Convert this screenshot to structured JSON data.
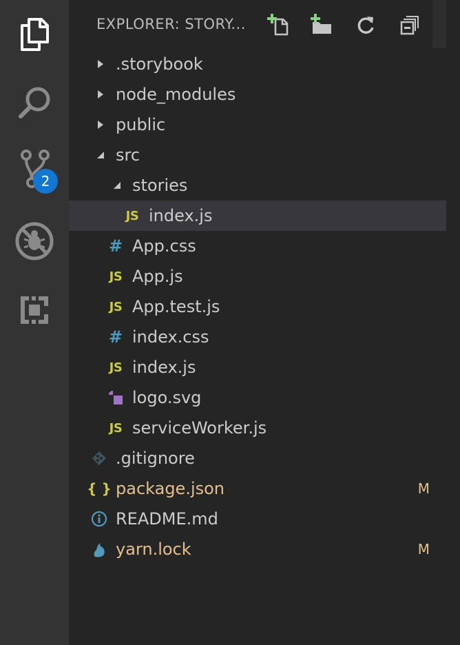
{
  "activity_bar": {
    "items": [
      {
        "name": "explorer",
        "icon": "files-icon"
      },
      {
        "name": "search",
        "icon": "search-icon"
      },
      {
        "name": "source-control",
        "icon": "source-control-icon",
        "badge": "2"
      },
      {
        "name": "debug",
        "icon": "debug-disabled-icon"
      },
      {
        "name": "extensions",
        "icon": "extensions-icon"
      }
    ],
    "badge_color": "#1177d1"
  },
  "explorer": {
    "title": "EXPLORER: STORY...",
    "actions": [
      {
        "name": "new-file",
        "icon": "new-file-icon"
      },
      {
        "name": "new-folder",
        "icon": "new-folder-icon"
      },
      {
        "name": "refresh",
        "icon": "refresh-icon"
      },
      {
        "name": "collapse-all",
        "icon": "collapse-all-icon"
      }
    ],
    "tree": [
      {
        "label": ".storybook",
        "type": "folder",
        "expanded": false
      },
      {
        "label": "node_modules",
        "type": "folder",
        "expanded": false
      },
      {
        "label": "public",
        "type": "folder",
        "expanded": false
      },
      {
        "label": "src",
        "type": "folder",
        "expanded": true
      },
      {
        "label": "stories",
        "type": "folder",
        "expanded": true
      },
      {
        "label": "index.js",
        "type": "js",
        "icon_text": "JS",
        "selected": true
      },
      {
        "label": "App.css",
        "type": "css",
        "icon_text": "#"
      },
      {
        "label": "App.js",
        "type": "js",
        "icon_text": "JS"
      },
      {
        "label": "App.test.js",
        "type": "js",
        "icon_text": "JS"
      },
      {
        "label": "index.css",
        "type": "css",
        "icon_text": "#"
      },
      {
        "label": "index.js",
        "type": "js",
        "icon_text": "JS"
      },
      {
        "label": "logo.svg",
        "type": "svg"
      },
      {
        "label": "serviceWorker.js",
        "type": "js",
        "icon_text": "JS"
      },
      {
        "label": ".gitignore",
        "type": "git"
      },
      {
        "label": "package.json",
        "type": "json",
        "icon_text": "{ }",
        "status": "M"
      },
      {
        "label": "README.md",
        "type": "info"
      },
      {
        "label": "yarn.lock",
        "type": "yarn",
        "status": "M"
      }
    ]
  },
  "colors": {
    "activity_bar_bg": "#333333",
    "sidebar_bg": "#252526",
    "selected_row_bg": "#37373d",
    "text": "#cccccc",
    "modified_text": "#e2c08d",
    "js_icon": "#cbcb41",
    "css_icon": "#519aba",
    "svg_icon": "#a074c4"
  }
}
